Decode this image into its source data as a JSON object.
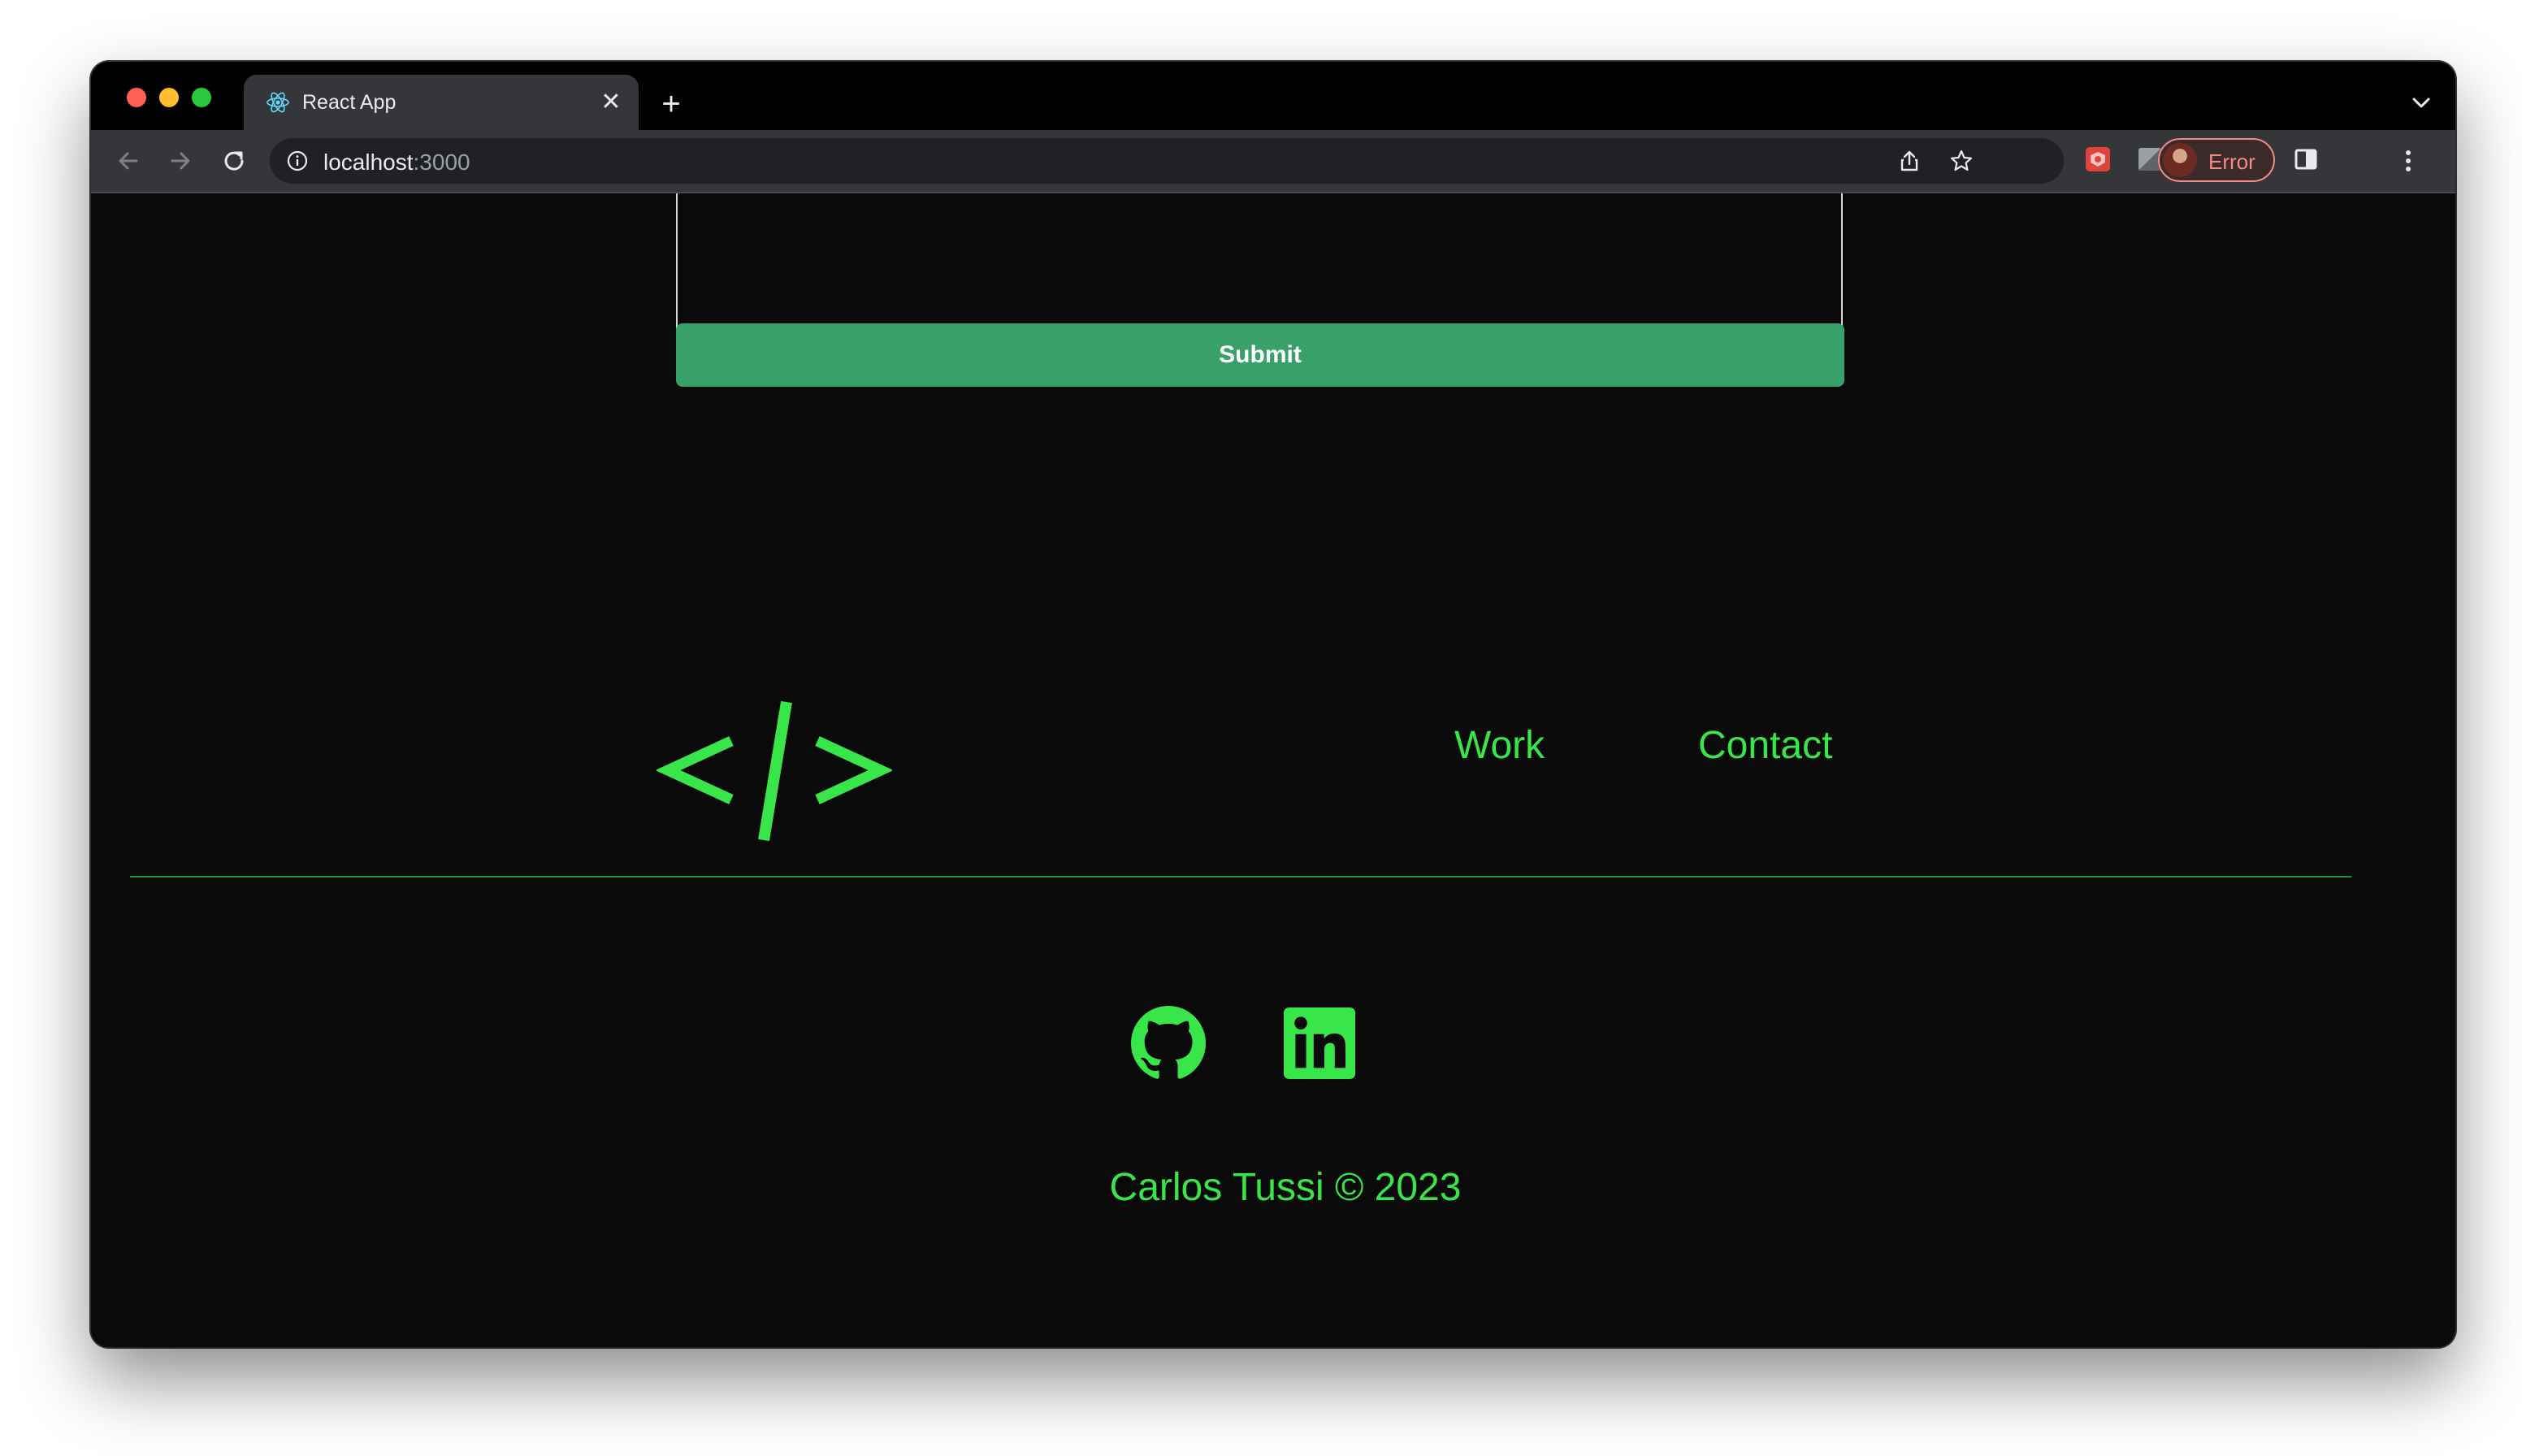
{
  "browser": {
    "tab": {
      "title": "React App",
      "favicon": "react-icon"
    },
    "address_bar": {
      "host": "localhost",
      "port": ":3000"
    },
    "profile": {
      "label": "Error"
    }
  },
  "page": {
    "contact_form": {
      "submit_label": "Submit"
    },
    "footer": {
      "logo_text": "</>",
      "nav": [
        {
          "label": "Work"
        },
        {
          "label": "Contact"
        }
      ],
      "social": [
        {
          "icon": "github-icon"
        },
        {
          "icon": "linkedin-icon"
        }
      ],
      "copyright": "Carlos Tussi © 2023"
    }
  },
  "colors": {
    "accent_green": "#39e64a",
    "submit_green": "#38a169",
    "page_background": "#0a0a0a"
  }
}
